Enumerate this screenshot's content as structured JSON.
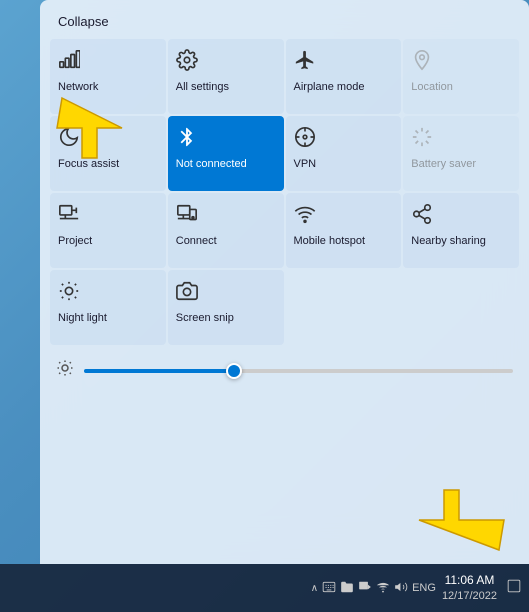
{
  "panel": {
    "collapse_label": "Collapse"
  },
  "tiles": [
    {
      "id": "network",
      "label": "Network",
      "icon": "🖧",
      "state": "normal"
    },
    {
      "id": "all-settings",
      "label": "All settings",
      "icon": "⚙",
      "state": "normal"
    },
    {
      "id": "airplane-mode",
      "label": "Airplane mode",
      "icon": "✈",
      "state": "normal"
    },
    {
      "id": "location",
      "label": "Location",
      "icon": "△",
      "state": "dimmed"
    },
    {
      "id": "focus-assist",
      "label": "Focus assist",
      "icon": "☽",
      "state": "normal"
    },
    {
      "id": "not-connected",
      "label": "Not connected",
      "icon": "✶",
      "state": "active"
    },
    {
      "id": "vpn",
      "label": "VPN",
      "icon": "⬡",
      "state": "normal"
    },
    {
      "id": "battery-saver",
      "label": "Battery saver",
      "icon": "◇",
      "state": "dimmed"
    },
    {
      "id": "project",
      "label": "Project",
      "icon": "⬜",
      "state": "normal"
    },
    {
      "id": "connect",
      "label": "Connect",
      "icon": "⬡",
      "state": "normal"
    },
    {
      "id": "mobile-hotspot",
      "label": "Mobile hotspot",
      "icon": "📶",
      "state": "normal"
    },
    {
      "id": "nearby-sharing",
      "label": "Nearby sharing",
      "icon": "⟳",
      "state": "normal"
    },
    {
      "id": "night-light",
      "label": "Night light",
      "icon": "☀",
      "state": "normal"
    },
    {
      "id": "screen-snip",
      "label": "Screen snip",
      "icon": "⛅",
      "state": "normal"
    }
  ],
  "brightness": {
    "icon": "☀",
    "value": 35
  },
  "taskbar": {
    "chevron": "∧",
    "ime_icon": "⌨",
    "folder_icon": "📁",
    "media_icon": "📺",
    "network_icon": "📶",
    "volume_icon": "🔊",
    "lang": "ENG",
    "time": "11:06 AM",
    "date": "12/17/2022",
    "notif_icon": "□"
  }
}
